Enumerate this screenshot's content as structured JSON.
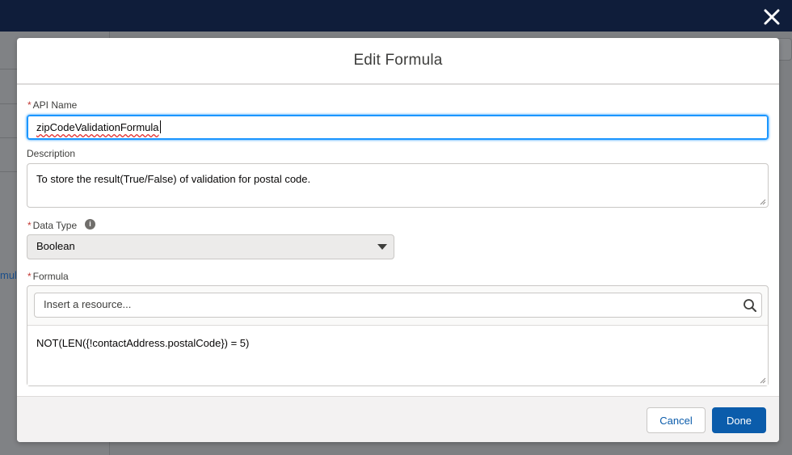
{
  "background": {
    "left_partial_text": "mula"
  },
  "modal": {
    "title": "Edit Formula",
    "api_name": {
      "label": "API Name",
      "required": "*",
      "value": "zipCodeValidationFormula"
    },
    "description": {
      "label": "Description",
      "value": "To store the result(True/False) of validation for postal code."
    },
    "data_type": {
      "label": "Data Type",
      "required": "*",
      "selected": "Boolean",
      "info_icon": "info-icon"
    },
    "formula": {
      "label": "Formula",
      "required": "*",
      "resource_placeholder": "Insert a resource...",
      "expression": "NOT(LEN({!contactAddress.postalCode}) = 5)"
    }
  },
  "footer": {
    "cancel_label": "Cancel",
    "done_label": "Done"
  },
  "colors": {
    "topbar": "#0f1d3a",
    "brand_button": "#0b5cab",
    "focus_border": "#1b96ff",
    "required": "#c23934"
  }
}
